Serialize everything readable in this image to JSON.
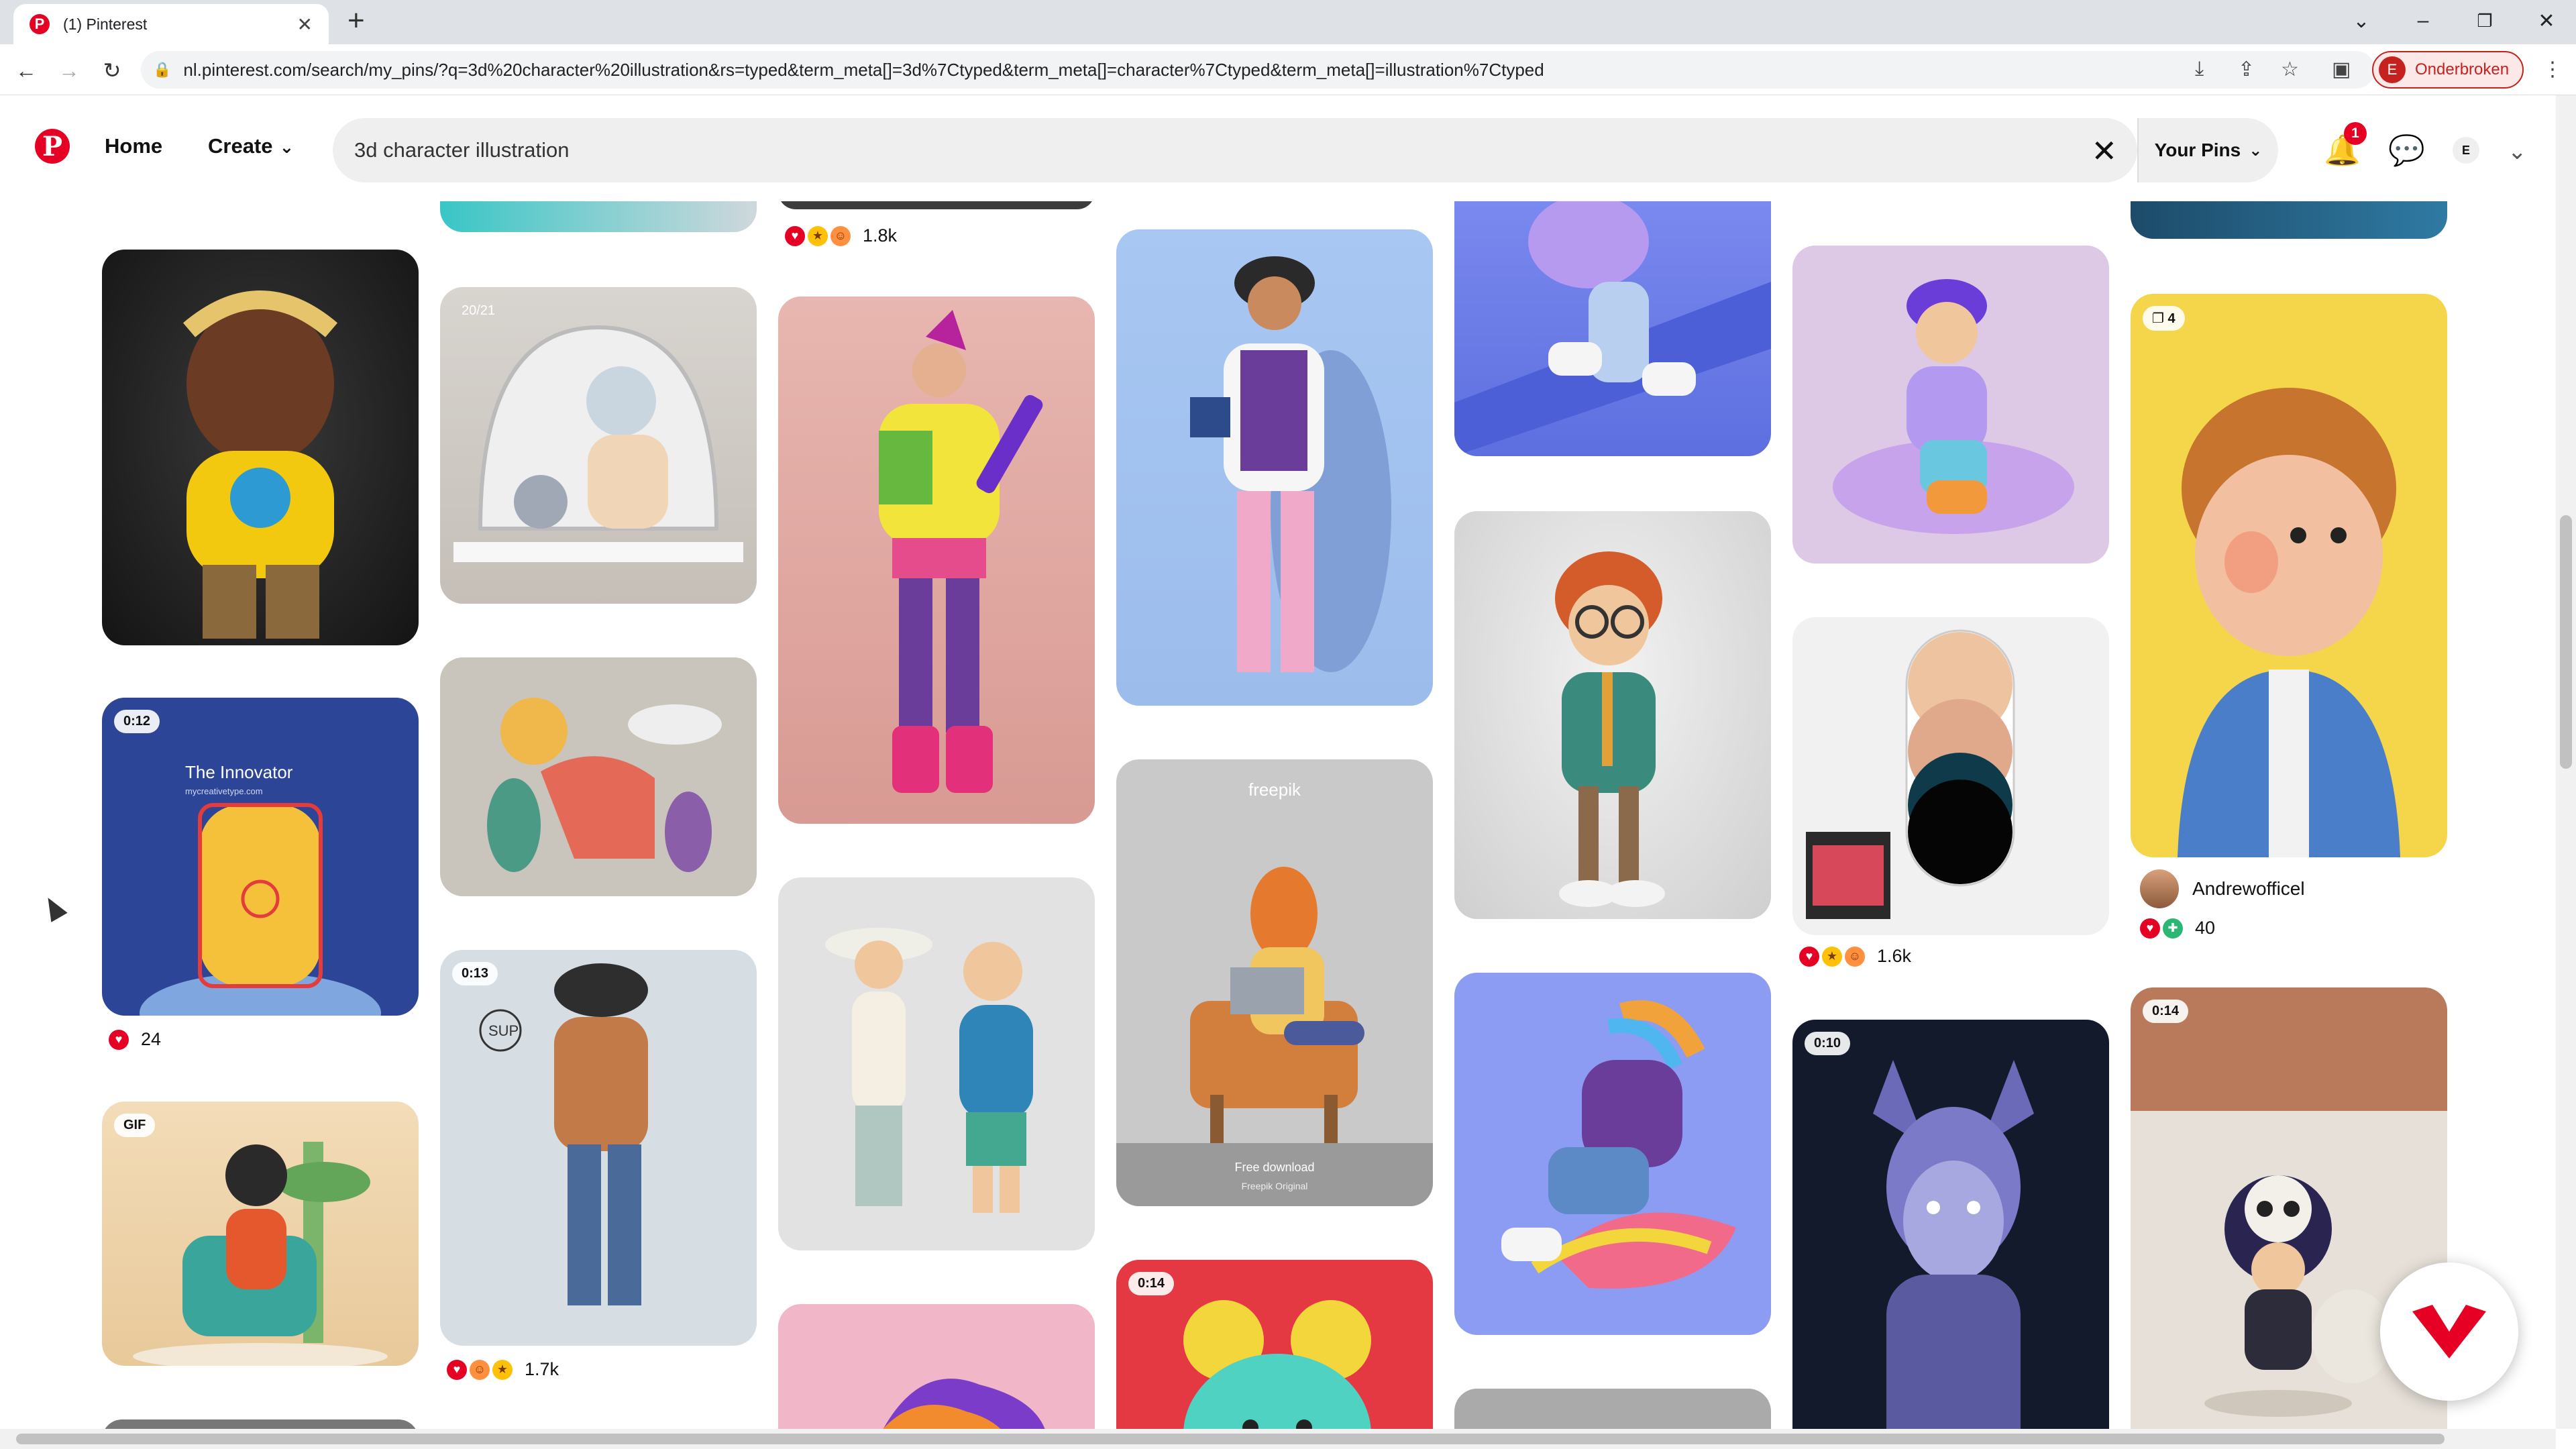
{
  "browser": {
    "tab_title": "(1) Pinterest",
    "url": "nl.pinterest.com/search/my_pins/?q=3d%20character%20illustration&rs=typed&term_meta[]=3d%7Ctyped&term_meta[]=character%7Ctyped&term_meta[]=illustration%7Ctyped",
    "profile_status": "Onderbroken",
    "profile_initial": "E"
  },
  "header": {
    "logo": "P",
    "home_label": "Home",
    "create_label": "Create",
    "search_value": "3d character illustration",
    "your_pins_label": "Your Pins",
    "notification_count": "1",
    "avatar_initial": "E"
  },
  "pins": {
    "p_innovator": {
      "timer": "0:12",
      "title": "The Innovator",
      "subtitle": "mycreativetype.com",
      "reactions": "24"
    },
    "p_gif": {
      "tag": "GIF"
    },
    "p_mirror": {
      "tag": "20/21"
    },
    "p_sup": {
      "timer": "0:13",
      "reactions": "1.7k",
      "doodle": "SUP"
    },
    "p_top3": {
      "reactions": "1.8k"
    },
    "p_freepik": {
      "brand": "freepik",
      "download": "Free download",
      "original": "Freepik Original"
    },
    "p_red": {
      "timer": "0:14"
    },
    "p_swatches": {
      "reactions": "1.6k"
    },
    "p_dragon": {
      "timer": "0:10"
    },
    "p_boy": {
      "tag": "4",
      "creator": "Andrewofficel",
      "reactions": "40"
    },
    "p_skull": {
      "timer": "0:14"
    }
  },
  "colors": {
    "brand_red": "#e60023",
    "search_bg": "#efefef"
  }
}
